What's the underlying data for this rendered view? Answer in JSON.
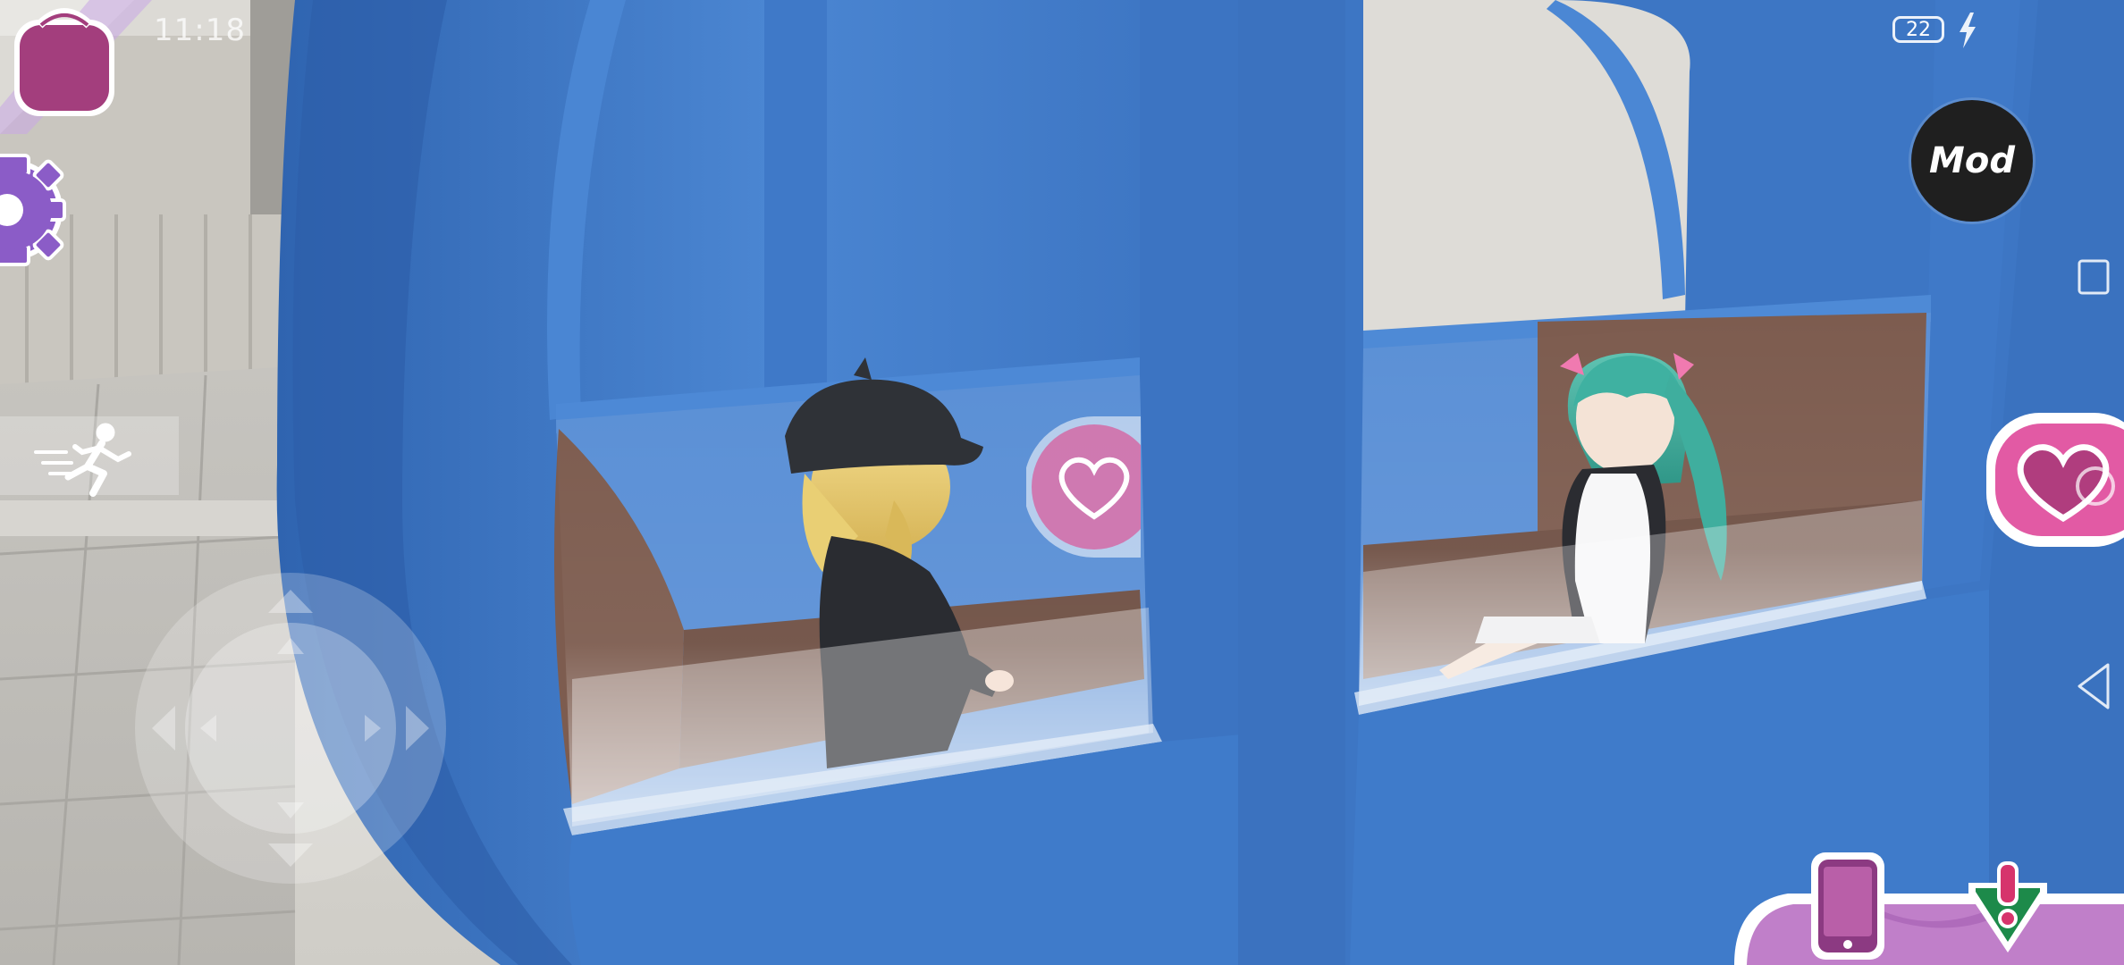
{
  "status_bar": {
    "time": "11:18",
    "battery_level": "22"
  },
  "hud": {
    "mod_label": "Mod",
    "icons": {
      "bag": "school-bag-icon",
      "settings": "gear-icon",
      "run": "running-person-icon",
      "joystick": "directional-pad",
      "like": "heart-icon",
      "phone": "smartphone-icon",
      "alert": "exclamation-shield-icon",
      "nav_recent": "square-icon",
      "nav_back": "triangle-back-icon"
    }
  },
  "colors": {
    "accent_pink": "#e25aa4",
    "accent_purple": "#8b5cc7",
    "gondola_blue": "#3f79c8",
    "mod_button": "#1f1f1f",
    "seat_brown": "#7b5a4c"
  }
}
